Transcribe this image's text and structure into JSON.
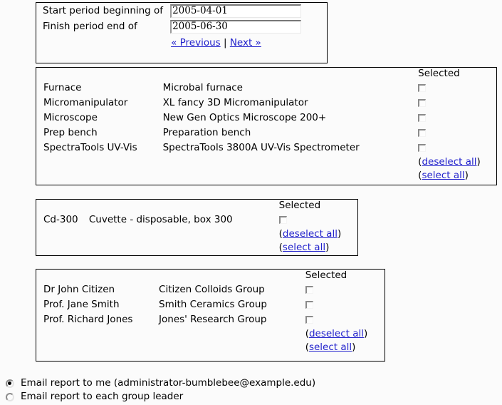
{
  "period": {
    "start_label": "Start period beginning of",
    "start_value": "2005-04-01",
    "finish_label": "Finish period end of",
    "finish_value": "2005-06-30",
    "previous_link": "« Previous",
    "separator": "|",
    "next_link": "Next »"
  },
  "common": {
    "selected_header": "Selected",
    "deselect_all": "deselect all",
    "select_all": "select all",
    "paren_open": "(",
    "paren_close": ")"
  },
  "equipment": {
    "rows": [
      {
        "code": "Furnace",
        "description": "Microbal furnace",
        "checked": false
      },
      {
        "code": "Micromanipulator",
        "description": "XL fancy 3D Micromanipulator",
        "checked": false
      },
      {
        "code": "Microscope",
        "description": "New Gen Optics Microscope 200+",
        "checked": false
      },
      {
        "code": "Prep bench",
        "description": "Preparation bench",
        "checked": false
      },
      {
        "code": "SpectraTools UV-Vis",
        "description": "SpectraTools 3800A UV-Vis Spectrometer",
        "checked": false
      }
    ]
  },
  "consumables": {
    "rows": [
      {
        "code": "Cd-300",
        "description": "Cuvette - disposable, box 300",
        "checked": false
      }
    ]
  },
  "groups": {
    "rows": [
      {
        "code": "Dr John Citizen",
        "description": "Citizen Colloids Group",
        "checked": false
      },
      {
        "code": "Prof. Jane Smith",
        "description": "Smith Ceramics Group",
        "checked": false
      },
      {
        "code": "Prof. Richard Jones",
        "description": "Jones' Research Group",
        "checked": false
      }
    ]
  },
  "email_options": [
    {
      "label": "Email report to me (administrator-bumblebee@example.edu)",
      "selected": true
    },
    {
      "label": "Email report to each group leader",
      "selected": false
    }
  ],
  "colors": {
    "link": "#2222cc",
    "text": "#000000",
    "background": "#fbfbfb",
    "box_border": "#000000",
    "control_border": "#8a8a8a"
  }
}
